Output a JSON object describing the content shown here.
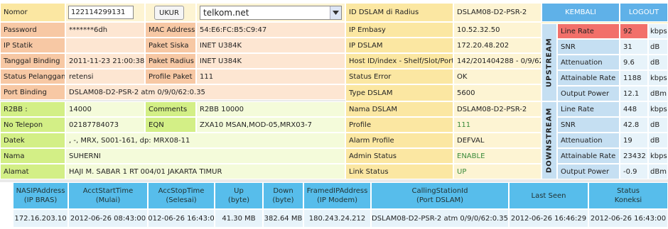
{
  "top": {
    "nomor_label": "Nomor",
    "nomor_value": "122114299131",
    "ukur_label": "UKUR",
    "domain_value": "telkom.net",
    "password_label": "Password",
    "password_value": "*******6dh",
    "mac_label": "MAC Address",
    "mac_value": "54:E6:FC:B5:C9:47",
    "ipstatik_label": "IP Statik",
    "ipstatik_value": "",
    "paket_siska_label": "Paket Siska",
    "paket_siska_value": "INET U384K",
    "tgl_label": "Tanggal Binding",
    "tgl_value": "2011-11-23 21:00:38",
    "paket_radius_label": "Paket Radius",
    "paket_radius_value": "INET U384K",
    "status_label": "Status Pelanggan",
    "status_value": "retensi",
    "profile_paket_label": "Profile Paket",
    "profile_paket_value": "111",
    "port_label": "Port Binding",
    "port_value": "DSLAM08-D2-PSR-2 atm 0/9/0/62:0.35",
    "r2bb_label": "R2BB :",
    "r2bb_value": "14000",
    "comments_label": "Comments",
    "comments_value": "R2BB 10000",
    "telp_label": "No Telepon",
    "telp_value": "02187784073",
    "eqn_label": "EQN",
    "eqn_value": "ZXA10 MSAN,MOD-05,MRX03-7",
    "datek_label": "Datek",
    "datek_value": ", -, MRX, S001-161, dp: MRX08-11",
    "nama_label": "Nama",
    "nama_value": "SUHERNI",
    "alamat_label": "Alamat",
    "alamat_value": "HAJI M. SABAR 1 RT 004/01 JAKARTA TIMUR"
  },
  "mid": {
    "rows": [
      {
        "label": "ID DSLAM di Radius",
        "value": "DSLAM08-D2-PSR-2"
      },
      {
        "label": "IP Embasy",
        "value": "10.52.32.50"
      },
      {
        "label": "IP DSLAM",
        "value": "172.20.48.202"
      },
      {
        "label": "Host ID/index -  Shelf/Slot/Port",
        "value": "142/201404288 - 0/9/62"
      },
      {
        "label": "Status Error",
        "value": "OK"
      },
      {
        "label": "Type DSLAM",
        "value": "5600"
      },
      {
        "label": "Nama DSLAM",
        "value": "DSLAM08-D2-PSR-2"
      },
      {
        "label": "Profile",
        "value": "111"
      },
      {
        "label": "Alarm Profile",
        "value": "DEFVAL"
      },
      {
        "label": "Admin Status",
        "value": "ENABLE"
      },
      {
        "label": "Link Status",
        "value": "UP"
      }
    ]
  },
  "nav": {
    "kembali": "KEMBALI",
    "logout": "LOGOUT"
  },
  "upstream": {
    "title": "UPSTREAM",
    "rows": [
      {
        "label": "Line Rate",
        "value": "92",
        "unit": "kbps"
      },
      {
        "label": "SNR",
        "value": "31",
        "unit": "dB"
      },
      {
        "label": "Attenuation",
        "value": "9.6",
        "unit": "dB"
      },
      {
        "label": "Attainable Rate",
        "value": "1188",
        "unit": "kbps"
      },
      {
        "label": "Output Power",
        "value": "12.1",
        "unit": "dBm"
      }
    ]
  },
  "downstream": {
    "title": "DOWNSTREAM",
    "rows": [
      {
        "label": "Line Rate",
        "value": "448",
        "unit": "kbps"
      },
      {
        "label": "SNR",
        "value": "42.8",
        "unit": "dB"
      },
      {
        "label": "Attenuation",
        "value": "19",
        "unit": "dB"
      },
      {
        "label": "Attainable Rate",
        "value": "23432",
        "unit": "kbps"
      },
      {
        "label": "Output Power",
        "value": "-0.9",
        "unit": "dBm"
      }
    ]
  },
  "session": {
    "headers": [
      {
        "l1": "NASIPAddress",
        "l2": "(IP BRAS)"
      },
      {
        "l1": "AcctStartTime",
        "l2": "(Mulai)"
      },
      {
        "l1": "AccStopTime",
        "l2": "(Selesai)"
      },
      {
        "l1": "Up",
        "l2": "(byte)"
      },
      {
        "l1": "Down",
        "l2": "(byte)"
      },
      {
        "l1": "FramedIPAddress",
        "l2": "(IP Modem)"
      },
      {
        "l1": "CallingStationId",
        "l2": "(Port DSLAM)"
      },
      {
        "l1": "Last Seen",
        "l2": ""
      },
      {
        "l1": "Status",
        "l2": "Koneksi"
      }
    ],
    "row": [
      "172.16.203.10",
      "2012-06-26 08:43:00",
      "2012-06-26 16:43:00",
      "41.30 MB",
      "382.64 MB",
      "180.243.24.212",
      "DSLAM08-D2-PSR-2 atm 0/9/0/62:0.35",
      "2012-06-26 16:46:29",
      "2012-06-26 16:43:00"
    ]
  }
}
